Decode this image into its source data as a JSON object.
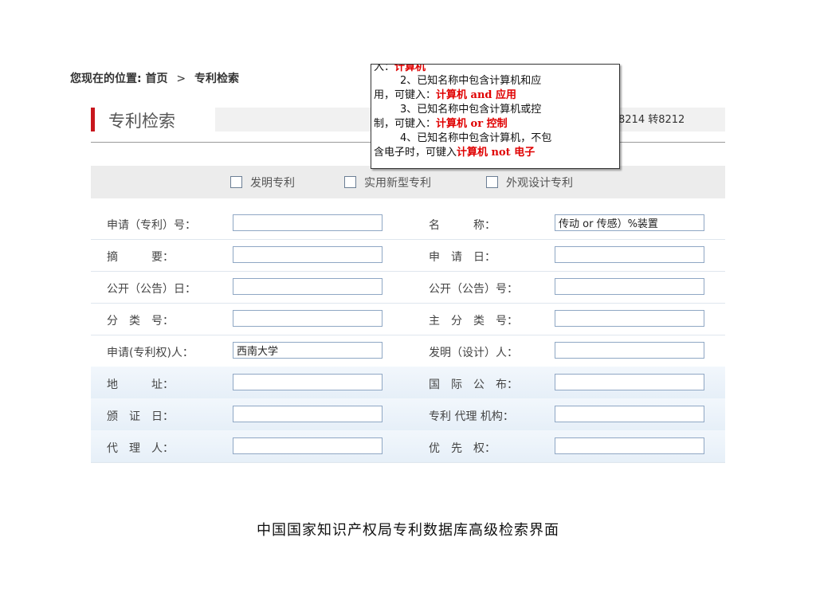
{
  "breadcrumb": {
    "prefix": "您现在的位置:",
    "home": "首页",
    "sep": ">",
    "current": "专利检索"
  },
  "header": {
    "title": "专利检索",
    "phone": "8214 转8212"
  },
  "patent_types": [
    {
      "label": "发明专利",
      "checked": false
    },
    {
      "label": "实用新型专利",
      "checked": false
    },
    {
      "label": "外观设计专利",
      "checked": false
    }
  ],
  "form": {
    "rows": [
      {
        "left_label": "申请（专利）号：",
        "left_value": "",
        "right_label": "名　　　称：",
        "right_value": "传动 or 传感）%装置"
      },
      {
        "left_label": "摘　　　要：",
        "left_value": "",
        "right_label": "申　请　日：",
        "right_value": ""
      },
      {
        "left_label": "公开（公告）日：",
        "left_value": "",
        "right_label": "公开（公告）号：",
        "right_value": ""
      },
      {
        "left_label": "分　类　号：",
        "left_value": "",
        "right_label": "主　分　类　号：",
        "right_value": ""
      },
      {
        "left_label": "申请(专利权)人：",
        "left_value": "西南大学",
        "right_label": "发明（设计）人：",
        "right_value": ""
      },
      {
        "left_label": "地　　　址：",
        "left_value": "",
        "right_label": "国　际　公　布：",
        "right_value": ""
      },
      {
        "left_label": "颁　证　日：",
        "left_value": "",
        "right_label": "专利 代理 机构：",
        "right_value": ""
      },
      {
        "left_label": "代　理　人：",
        "left_value": "",
        "right_label": "优　先　权：",
        "right_value": ""
      }
    ]
  },
  "tooltip": {
    "line0": {
      "text": "入：",
      "kw": "计算机"
    },
    "line1": "2、已知名称中包含计算机和应",
    "line2": {
      "text": "用，可键入：",
      "kw": "计算机 and 应用"
    },
    "line3": "3、已知名称中包含计算机或控",
    "line4": {
      "text": "制，可键入：",
      "kw": "计算机 or 控制"
    },
    "line5": "4、已知名称中包含计算机，不包",
    "line6": {
      "text": "含电子时，可键入",
      "kw": "计算机 not 电子"
    }
  },
  "caption": "中国国家知识产权局专利数据库高级检索界面"
}
